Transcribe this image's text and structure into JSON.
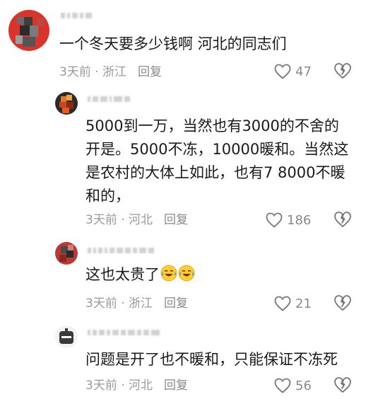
{
  "comments": [
    {
      "text": "一个冬天要多少钱啊 河北的同志们",
      "time": "3天前",
      "location": "浙江",
      "reply_label": "回复",
      "likes": "47"
    },
    {
      "lines": [
        "5000到一万，当然也有3000的不舍的",
        "开是。5000不冻，10000暖和。当然这",
        "是农村的大体上如此，也有7 8000不暖",
        "和的，"
      ],
      "time": "3天前",
      "location": "河北",
      "reply_label": "回复",
      "likes": "186"
    },
    {
      "text": "这也太贵了",
      "emoji": [
        "crying-laughing-emoji",
        "crying-laughing-emoji"
      ],
      "time": "3天前",
      "location": "浙江",
      "reply_label": "回复",
      "likes": "21"
    },
    {
      "text": "问题是开了也不暖和，只能保证不冻死",
      "time": "3天前",
      "location": "河北",
      "reply_label": "回复",
      "likes": "56"
    }
  ],
  "colors": {
    "meta": "#9a9a9a",
    "text": "#1a1a1a",
    "avatar_red": "#d9342b"
  }
}
